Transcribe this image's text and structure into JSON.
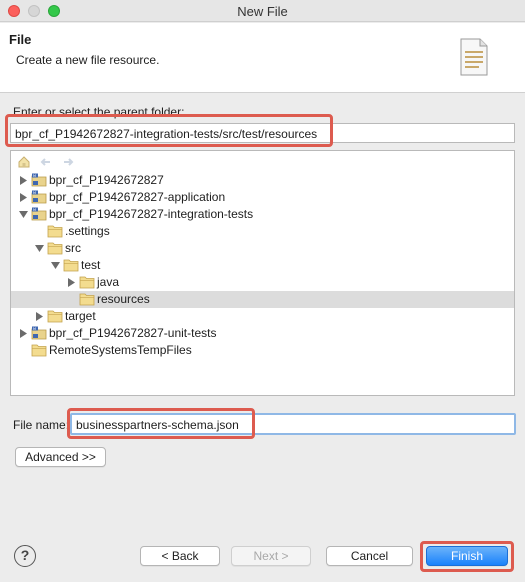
{
  "window": {
    "title": "New File"
  },
  "header": {
    "title": "File",
    "description": "Create a new file resource.",
    "icon": "new-file-wizard-icon"
  },
  "parent_folder": {
    "label": "Enter or select the parent folder:",
    "value": "bpr_cf_P1942672827-integration-tests/src/test/resources"
  },
  "tree": {
    "items": [
      {
        "label": "bpr_cf_P1942672827",
        "icon": "maven-project-icon",
        "expanded": false,
        "selected": false
      },
      {
        "label": "bpr_cf_P1942672827-application",
        "icon": "maven-project-icon",
        "expanded": false,
        "selected": false
      },
      {
        "label": "bpr_cf_P1942672827-integration-tests",
        "icon": "maven-project-icon",
        "expanded": true,
        "selected": false
      },
      {
        "label": ".settings",
        "icon": "folder-icon",
        "expanded": null,
        "selected": false
      },
      {
        "label": "src",
        "icon": "folder-icon",
        "expanded": true,
        "selected": false
      },
      {
        "label": "test",
        "icon": "folder-icon",
        "expanded": true,
        "selected": false
      },
      {
        "label": "java",
        "icon": "folder-icon",
        "expanded": false,
        "selected": false
      },
      {
        "label": "resources",
        "icon": "folder-icon",
        "expanded": null,
        "selected": true
      },
      {
        "label": "target",
        "icon": "folder-icon",
        "expanded": false,
        "selected": false
      },
      {
        "label": "bpr_cf_P1942672827-unit-tests",
        "icon": "maven-project-icon",
        "expanded": false,
        "selected": false
      },
      {
        "label": "RemoteSystemsTempFiles",
        "icon": "folder-icon",
        "expanded": null,
        "selected": false
      }
    ]
  },
  "file_name": {
    "label": "File name:",
    "value": "businesspartners-schema.json"
  },
  "buttons": {
    "advanced": "Advanced >>",
    "back": "< Back",
    "next": "Next >",
    "cancel": "Cancel",
    "finish": "Finish"
  },
  "help": {
    "icon": "help-icon",
    "glyph": "?"
  },
  "colors": {
    "highlight": "#dd5b4f",
    "accent": "#1a82fb",
    "selected_row": "#dcdcdc"
  }
}
